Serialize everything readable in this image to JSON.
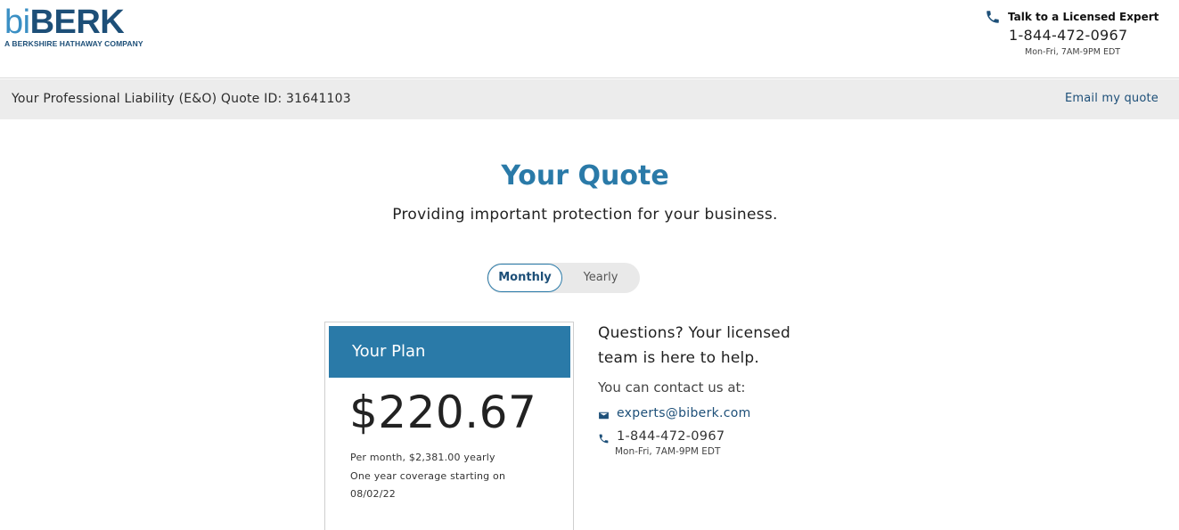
{
  "header": {
    "logo": {
      "bi": "bi",
      "berk": "BERK",
      "tagline": "A BERKSHIRE HATHAWAY COMPANY"
    },
    "contact": {
      "icon": "phone-icon",
      "label": "Talk to a Licensed Expert",
      "phone": "1-844-472-0967",
      "hours": "Mon-Fri, 7AM-9PM EDT"
    }
  },
  "quote_bar": {
    "quote_id_text": "Your Professional Liability (E&O) Quote ID: 31641103",
    "email_link": "Email my quote"
  },
  "main": {
    "title": "Your Quote",
    "subtitle": "Providing important protection for your business.",
    "billing_toggle": {
      "options": [
        "Monthly",
        "Yearly"
      ],
      "selected": "Monthly"
    }
  },
  "plan": {
    "heading": "Your Plan",
    "price": "$220.67",
    "line1": "Per month, $2,381.00 yearly",
    "line2": "One year coverage starting on",
    "line3": "08/02/22"
  },
  "help": {
    "title": "Questions? Your licensed team is here to help.",
    "contact_intro": "You can contact us at:",
    "email": "experts@biberk.com",
    "email_icon": "mail-icon",
    "phone": "1-844-472-0967",
    "phone_icon": "phone-icon",
    "hours": "Mon-Fri, 7AM-9PM EDT"
  },
  "colors": {
    "brand_blue": "#2a7aa8",
    "brand_dark": "#1d4f78",
    "bar_gray": "#ececec"
  }
}
